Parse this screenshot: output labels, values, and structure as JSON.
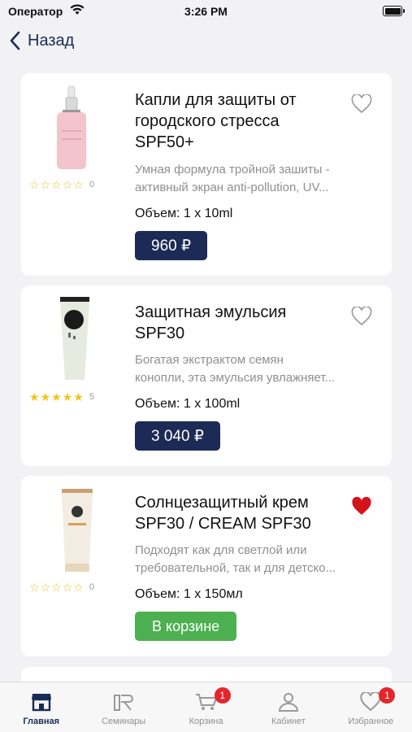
{
  "status": {
    "carrier": "Оператор",
    "time": "3:26 PM"
  },
  "nav": {
    "back_label": "Назад"
  },
  "products": [
    {
      "title": "Капли для защиты от городского стресса SPF50+",
      "desc_line1": "Умная формула тройной зашиты -",
      "desc_line2": "активный экран anti-pollution, UV...",
      "rating": 0,
      "rating_count": "0",
      "volume": "Объем: 1 x 10ml",
      "price": "960 ₽",
      "favorite": false
    },
    {
      "title": "Защитная эмульсия SPF30",
      "desc_line1": "Богатая экстрактом семян",
      "desc_line2": "конопли, эта эмульсия увлажняет...",
      "rating": 5,
      "rating_count": "5",
      "volume": "Объем: 1 x 100ml",
      "price": "3 040 ₽",
      "favorite": false
    },
    {
      "title": "Солнцезащитный крем SPF30 / CREAM SPF30",
      "desc_line1": "Подходят как для светлой или",
      "desc_line2": "требовательной, так и для детско...",
      "rating": 0,
      "rating_count": "0",
      "volume": "Объем: 1 x 150мл",
      "cart_label": "В корзине",
      "favorite": true
    }
  ],
  "tabs": [
    {
      "label": "Главная",
      "icon": "shop-icon",
      "active": true
    },
    {
      "label": "Семинары",
      "icon": "seminar-icon",
      "active": false
    },
    {
      "label": "Корзина",
      "icon": "cart-icon",
      "badge": "1",
      "active": false
    },
    {
      "label": "Кабинет",
      "icon": "user-icon",
      "active": false
    },
    {
      "label": "Избранное",
      "icon": "heart-icon",
      "badge": "1",
      "active": false
    }
  ],
  "colors": {
    "primary": "#1b2b55",
    "in_cart": "#4cb050",
    "badge": "#e3262b",
    "favorite": "#d4141c",
    "star": "#f3c318"
  }
}
